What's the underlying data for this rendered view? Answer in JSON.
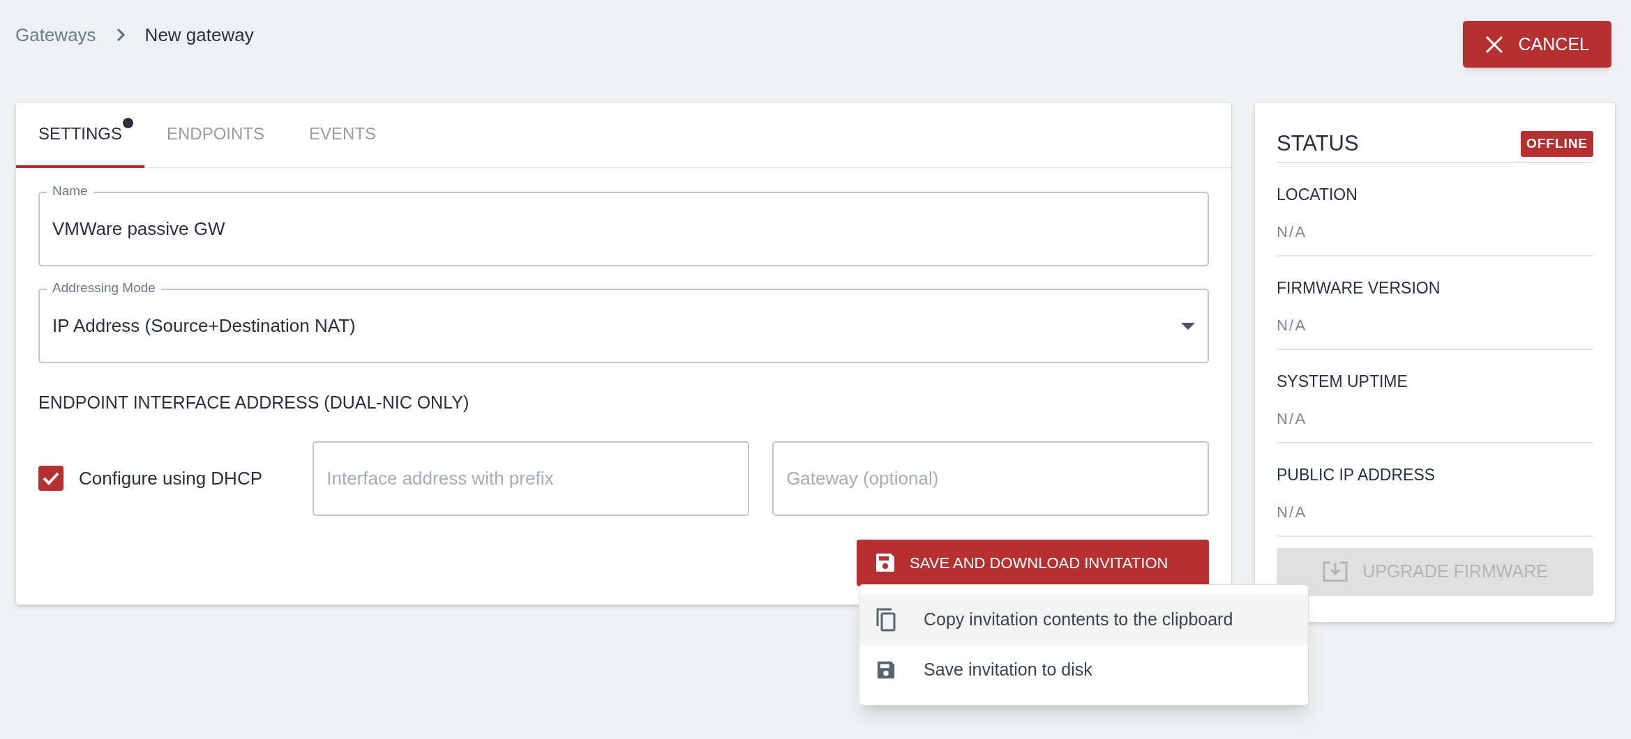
{
  "breadcrumb": [
    {
      "label": "Gateways",
      "kind": "link"
    },
    {
      "label": "New gateway",
      "kind": "current"
    }
  ],
  "cancel_button": "CANCEL",
  "tabs": [
    {
      "label": "SETTINGS",
      "selected": true,
      "modified": true
    },
    {
      "label": "ENDPOINTS",
      "selected": false,
      "modified": false
    },
    {
      "label": "EVENTS",
      "selected": false,
      "modified": false
    }
  ],
  "form": {
    "name_field": {
      "label": "Name",
      "value": "VMWare passive GW"
    },
    "addressing_mode": {
      "label": "Addressing Mode",
      "value": "IP Address (Source+Destination NAT)"
    },
    "section_heading": "ENDPOINT INTERFACE ADDRESS (DUAL-NIC ONLY)",
    "dhcp_checkbox": {
      "label": "Configure using DHCP",
      "checked": true
    },
    "interface_field": {
      "placeholder": "Interface address with prefix"
    },
    "gateway_field": {
      "placeholder": "Gateway (optional)"
    },
    "save_button": "SAVE AND DOWNLOAD INVITATION"
  },
  "save_menu": [
    {
      "label": "Copy invitation contents to the clipboard",
      "kind": "copy",
      "selected": true
    },
    {
      "label": "Save invitation to disk",
      "kind": "save",
      "selected": false
    }
  ],
  "status": {
    "title": "STATUS",
    "badge": "OFFLINE",
    "items": [
      {
        "label": "LOCATION",
        "value": "N/A"
      },
      {
        "label": "FIRMWARE VERSION",
        "value": "N/A"
      },
      {
        "label": "SYSTEM UPTIME",
        "value": "N/A"
      },
      {
        "label": "PUBLIC IP ADDRESS",
        "value": "N/A"
      }
    ],
    "upgrade_button": {
      "label": "UPGRADE FIRMWARE",
      "disabled": true
    }
  }
}
